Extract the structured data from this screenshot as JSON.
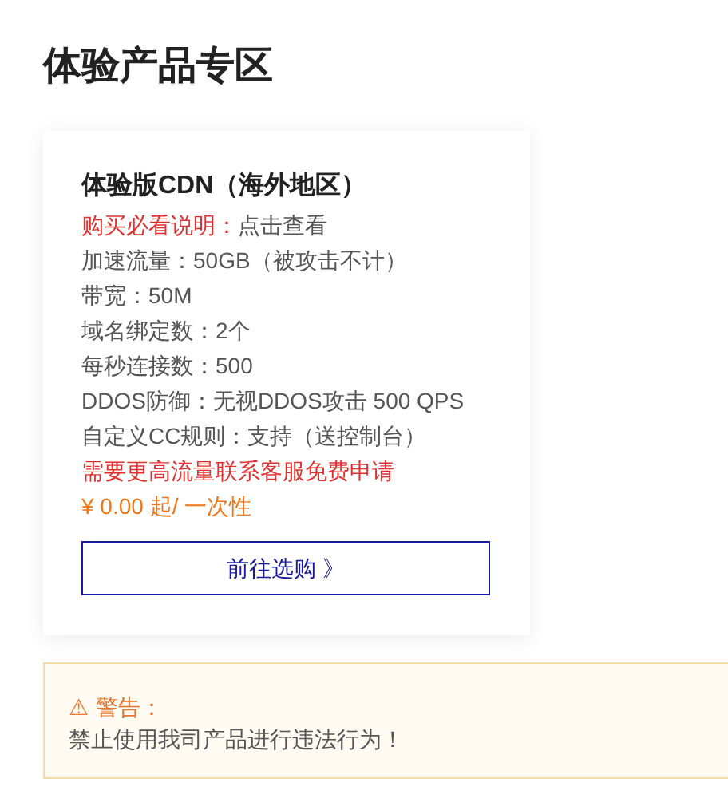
{
  "page_title": "体验产品专区",
  "products": [
    {
      "name": "体验版CDN（海外地区）",
      "lines": [
        {
          "kind": "split",
          "label": "购买必看说明：",
          "value": "点击查看"
        },
        {
          "kind": "plain",
          "text": "加速流量：50GB（被攻击不计）"
        },
        {
          "kind": "plain",
          "text": "带宽：50M"
        },
        {
          "kind": "plain",
          "text": "域名绑定数：2个"
        },
        {
          "kind": "plain",
          "text": "每秒连接数：500"
        },
        {
          "kind": "plain",
          "text": "DDOS防御：无视DDOS攻击 500 QPS"
        },
        {
          "kind": "plain",
          "text": "自定义CC规则：支持（送控制台）"
        },
        {
          "kind": "alert",
          "text": "需要更高流量联系客服免费申请"
        },
        {
          "kind": "price",
          "text": "¥ 0.00 起/ 一次性"
        }
      ],
      "button": "前往选购 》"
    }
  ],
  "warning": {
    "icon": "⚠",
    "title": "警告：",
    "message": "禁止使用我司产品进行违法行为！"
  }
}
